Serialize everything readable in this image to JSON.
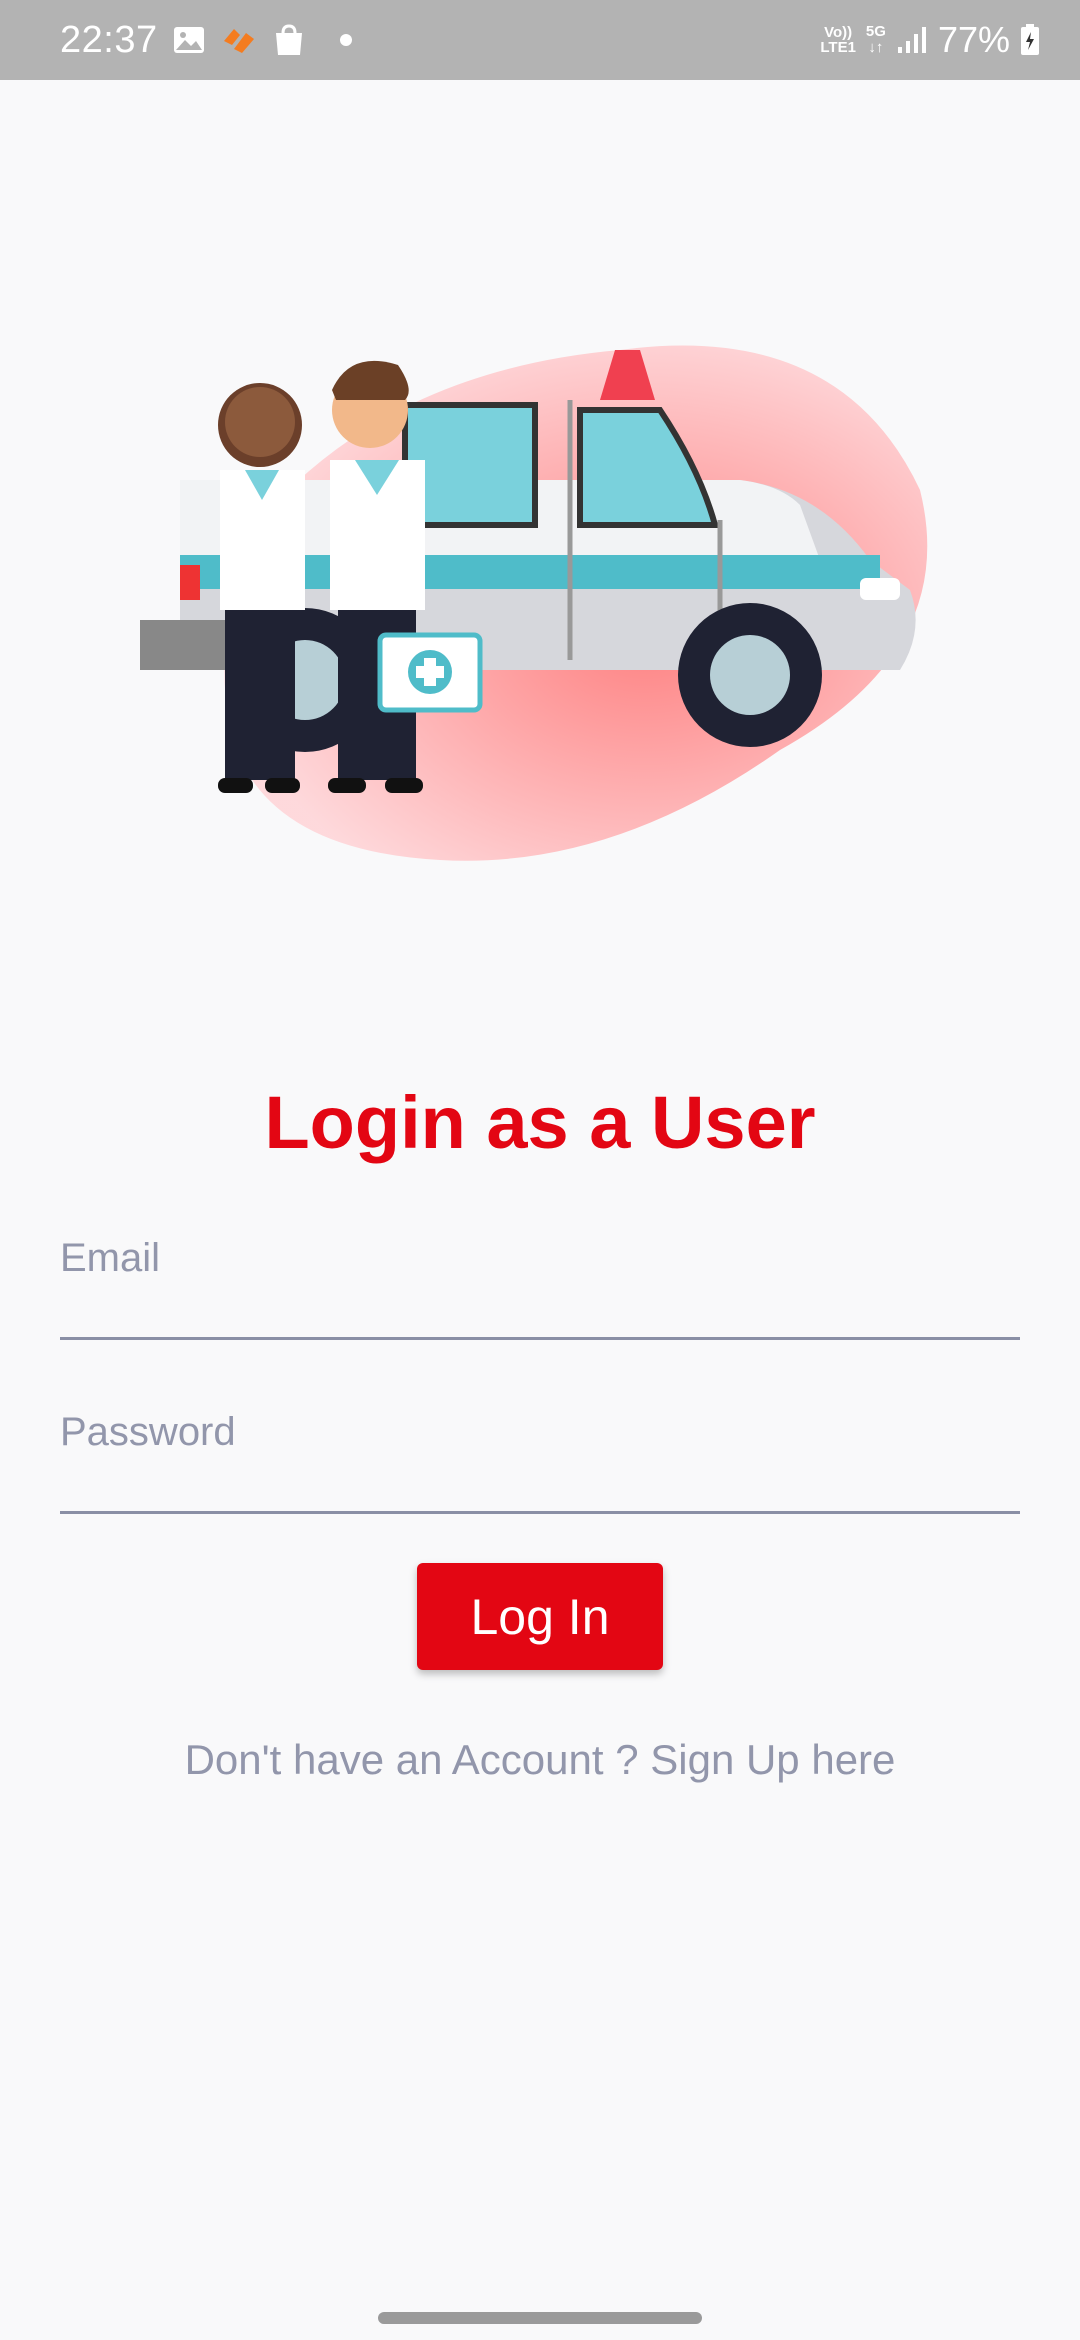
{
  "status_bar": {
    "time": "22:37",
    "notification_icons": [
      "image-icon",
      "orange-app-icon",
      "shopping-bag-icon",
      "dot-icon"
    ],
    "network_label_top": "Vo))",
    "network_label_bottom": "LTE1",
    "network_5g": "5G",
    "battery": "77%"
  },
  "hero": {
    "illustration": "ambulance-with-doctors"
  },
  "login": {
    "title": "Login as a User",
    "email_placeholder": "Email",
    "password_placeholder": "Password",
    "button_label": "Log In",
    "signup_text": "Don't have an Account ? Sign Up here"
  },
  "colors": {
    "accent": "#e30613",
    "muted_text": "#9296ab",
    "background": "#f9f9fa",
    "status_bar": "#b3b3b3"
  }
}
